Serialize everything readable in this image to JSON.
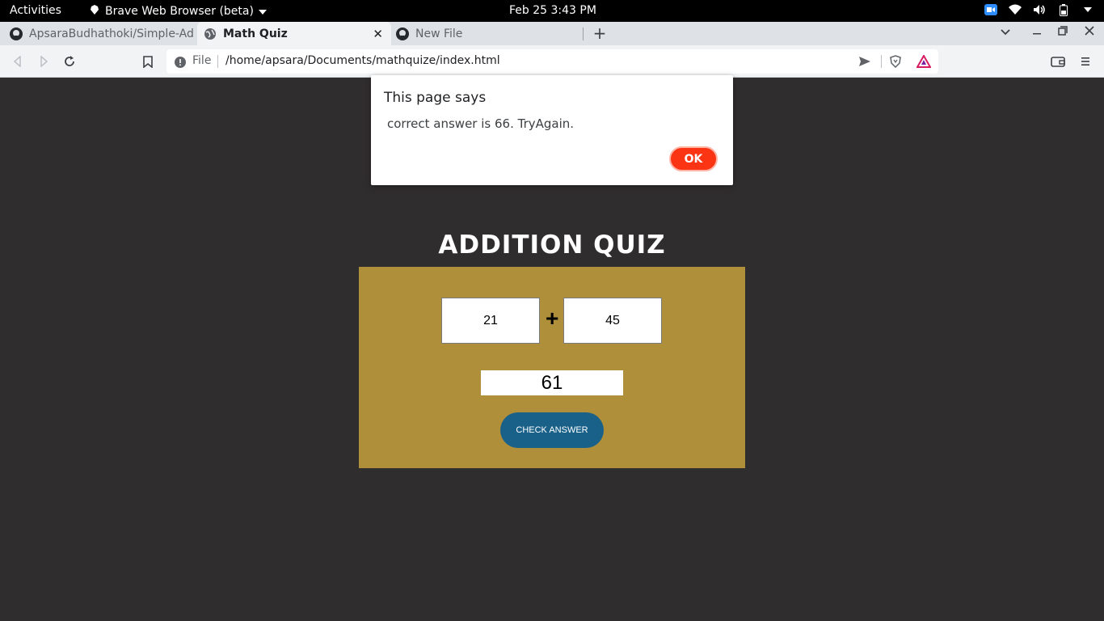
{
  "topbar": {
    "activities": "Activities",
    "app_name": "Brave Web Browser (beta)",
    "clock": "Feb 25  3:43 PM"
  },
  "tabs": [
    {
      "label": "ApsaraBudhathoki/Simple-Ad",
      "icon": "github-icon"
    },
    {
      "label": "Math Quiz",
      "icon": "globe-icon"
    },
    {
      "label": "New File",
      "icon": "github-icon"
    }
  ],
  "toolbar": {
    "scheme": "File",
    "url": "/home/apsara/Documents/mathquize/index.html"
  },
  "dialog": {
    "title": "This page says",
    "message": "correct answer is 66. TryAgain.",
    "ok_label": "OK"
  },
  "quiz": {
    "title": "ADDITION QUIZ",
    "first_number": "21",
    "operator": "+",
    "second_number": "45",
    "answer_value": "61",
    "check_label": "CHECK ANSWER"
  },
  "colors": {
    "page_bg": "#302d2e",
    "quiz_box": "#af8f3a",
    "check_button": "#1a6189",
    "ok_button": "#fb3414"
  }
}
